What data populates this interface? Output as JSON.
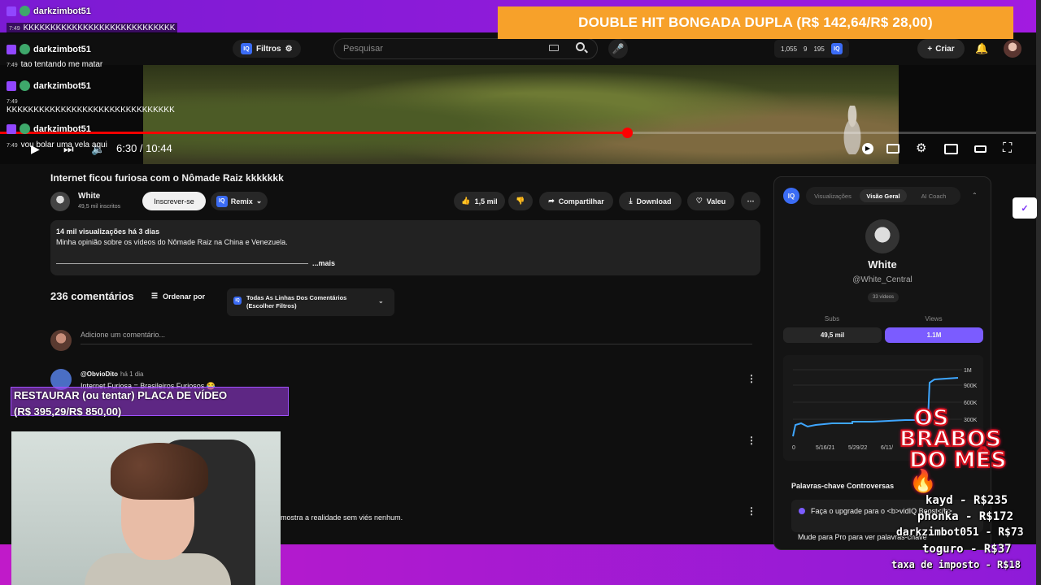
{
  "donation_banner": "DOUBLE HIT BONGADA DUPLA (R$ 142,64/R$ 28,00)",
  "chat": [
    {
      "user": "darkzimbot51",
      "time": "7:49",
      "text": "KKKKKKKKKKKKKKKKKKKKKKKKKKKK"
    },
    {
      "user": "darkzimbot51",
      "time": "7:49",
      "text": "tao tentando me matar"
    },
    {
      "user": "darkzimbot51",
      "time": "7:49",
      "text": "KKKKKKKKKKKKKKKKKKKKKKKKKKKKKKK"
    },
    {
      "user": "darkzimbot51",
      "time": "7:49",
      "text": "vou bolar uma vela aqui"
    }
  ],
  "header": {
    "filtros_label": "Filtros",
    "search_placeholder": "Pesquisar",
    "stats": [
      "1,055",
      "9",
      "195"
    ],
    "criar_label": "Criar"
  },
  "player": {
    "current_time": "6:30",
    "duration": "10:44",
    "time_display": "6:30 / 10:44",
    "progress_fraction": 0.605
  },
  "video": {
    "title": "Internet ficou furiosa com o Nômade Raiz kkkkkkk",
    "channel_name": "White",
    "channel_subs": "49,5 mil inscritos",
    "subscribe_label": "Inscrever-se",
    "remix_label": "Remix",
    "likes": "1,5 mil",
    "share_label": "Compartilhar",
    "download_label": "Download",
    "thanks_label": "Valeu"
  },
  "description": {
    "meta": "14 mil visualizações  há 3 dias",
    "text": "Minha opinião sobre os vídeos do Nômade Raiz na China e Venezuela.",
    "more_label": "...mais"
  },
  "comments": {
    "count_label": "236 comentários",
    "sort_label": "Ordenar por",
    "filter_label": "Todas As Linhas Dos Comentários (Escolher Filtros)",
    "add_placeholder": "Adicione um comentário...",
    "items": [
      {
        "author": "@ObvioDito",
        "ago": "há 1 dia",
        "text": "Internet Furiosa = Brasileiros Furiosos 😂"
      },
      {
        "author": "",
        "ago": "",
        "text": "mostra a realidade sem viés nenhum."
      }
    ]
  },
  "goal_overlay": {
    "line1": "RESTAURAR (ou tentar) PLACA DE VÍDEO",
    "line2": "(R$ 395,29/R$ 850,00)"
  },
  "iq_panel": {
    "logo": "IQ",
    "tabs": [
      "Visualizações",
      "Visão Geral",
      "AI Coach"
    ],
    "active_tab": "Visão Geral",
    "channel_name": "White",
    "handle": "@White_Central",
    "videos_badge": "33 vídeos",
    "subs_label": "Subs",
    "subs_value": "49,5 mil",
    "views_label": "Views",
    "views_value": "1.1M",
    "chart_y_ticks": [
      "1M",
      "900K",
      "600K",
      "300K"
    ],
    "chart_x_ticks": [
      "0",
      "5/16/21",
      "5/29/22",
      "6/11/"
    ],
    "keywords_title": "Palavras-chave Controversas",
    "upgrade_text": "Faça o upgrade para o <b>vidIQ Boost</b>",
    "upgrade_more": "Mude para Pro para ver palavras-chave"
  },
  "brabos": {
    "title_lines": [
      "OS",
      "BRABOS",
      "DO MÊS 🔥"
    ],
    "ranking": [
      "kayd - R$235",
      "phonka - R$172",
      "darkzimbot051 - R$73",
      "toguro - R$37",
      "taxa de imposto - R$18"
    ]
  },
  "colors": {
    "stream_frame": "#8e1bd9",
    "donation_banner": "#f7a12a",
    "progress": "#ff0000",
    "views_button": "#7b5cff",
    "subs_button": "#262626"
  }
}
